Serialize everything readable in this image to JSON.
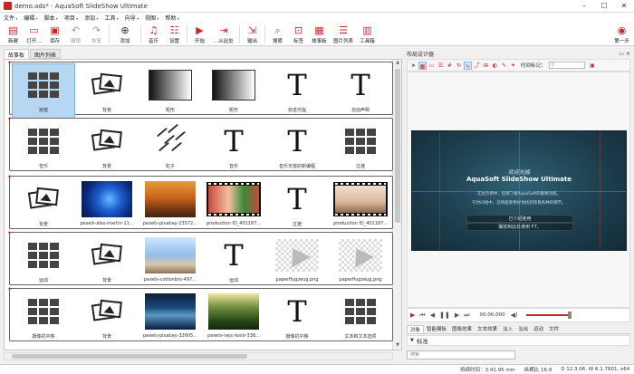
{
  "window": {
    "title": "demo.ads* - AquaSoft SlideShow Ultimate"
  },
  "menu": [
    "文件",
    "编辑",
    "脚本",
    "项目",
    "添加",
    "工具",
    "向导",
    "视图",
    "帮助"
  ],
  "toolbar": {
    "new": "新建",
    "open": "打开...",
    "save": "保存",
    "undo": "撤销",
    "redo": "恢复",
    "add": "添加",
    "music": "音乐",
    "settings": "设置",
    "start": "开始",
    "from_here": "...从此处",
    "output": "输出",
    "search": "搜索",
    "tags": "标签",
    "storyboard": "故事板",
    "image_list": "图片列表",
    "toolbox": "工具箱",
    "first_steps": "第一步"
  },
  "left_tabs": [
    "故事板",
    "图片列表"
  ],
  "storyboard": {
    "rows": [
      {
        "items": [
          {
            "icon": "brick",
            "label": "双迹"
          },
          {
            "icon": "photo",
            "label": "背景"
          },
          {
            "icon": "gradient",
            "label": "矩形"
          },
          {
            "icon": "gradient",
            "label": "矩形"
          },
          {
            "icon": "text",
            "label": "双迹光临"
          },
          {
            "icon": "text",
            "label": "自动声明"
          }
        ]
      },
      {
        "items": [
          {
            "icon": "brick",
            "label": "音乐"
          },
          {
            "icon": "photo",
            "label": "背景"
          },
          {
            "icon": "meteor",
            "label": "粒子"
          },
          {
            "icon": "text",
            "label": "音乐"
          },
          {
            "icon": "text",
            "label": "音乐天窗的新编程"
          },
          {
            "icon": "brick",
            "label": "过渡"
          }
        ]
      },
      {
        "items": [
          {
            "icon": "photo",
            "label": "背景"
          },
          {
            "icon": "img-blue",
            "label": "pexels-ales-martin-11..."
          },
          {
            "icon": "img-autumn",
            "label": "pexels-pixabay-23572..."
          },
          {
            "icon": "film",
            "label": "production ID_401187..."
          },
          {
            "icon": "text",
            "label": "过渡"
          },
          {
            "icon": "film-baby",
            "label": "production ID_401187..."
          }
        ]
      },
      {
        "items": [
          {
            "icon": "brick",
            "label": "运动"
          },
          {
            "icon": "photo",
            "label": "背景"
          },
          {
            "icon": "img-couple",
            "label": "pexels-cottonbro-497..."
          },
          {
            "icon": "text",
            "label": "运动"
          },
          {
            "icon": "plane",
            "label": "paperflugzeug.png"
          },
          {
            "icon": "plane",
            "label": "paperflugzeug.png"
          }
        ]
      },
      {
        "items": [
          {
            "icon": "brick",
            "label": "摄像机平移"
          },
          {
            "icon": "photo",
            "label": "背景"
          },
          {
            "icon": "img-night",
            "label": "pexels-pixabay-32605..."
          },
          {
            "icon": "img-forest",
            "label": "pexels-nejc-košir-338..."
          },
          {
            "icon": "text",
            "label": "摄像机平移"
          },
          {
            "icon": "brick",
            "label": "文本和文本选项"
          }
        ]
      }
    ]
  },
  "designer": {
    "title": "布局设计器",
    "time_label": "时间标记：",
    "preview": {
      "welcome": "欢迎光临",
      "title": "AquaSoft SlideShow Ultimate",
      "line1": "在此示例中，您将了解AquaSoft的重要功能。",
      "line2": "在时间线中，您将能够更好地找到项目各种的细节。",
      "box1": "已介绍使用",
      "box2": "播放到此处使用 F7。"
    },
    "time": "00:00.000"
  },
  "prop_tabs": [
    "对象",
    "智能模板",
    "图像效果",
    "文本效果",
    "淡入",
    "淡出",
    "运动",
    "文件"
  ],
  "prop_section": "标准",
  "search_placeholder": "搜索",
  "status": {
    "duration": "持续时间：3:41.95 min",
    "aspect": "纵横比 16:9",
    "version": "D 12.3.06, W 6.1.7601, x64"
  },
  "colors": {
    "accent": "#c62828",
    "selection": "#b7d6f2"
  }
}
